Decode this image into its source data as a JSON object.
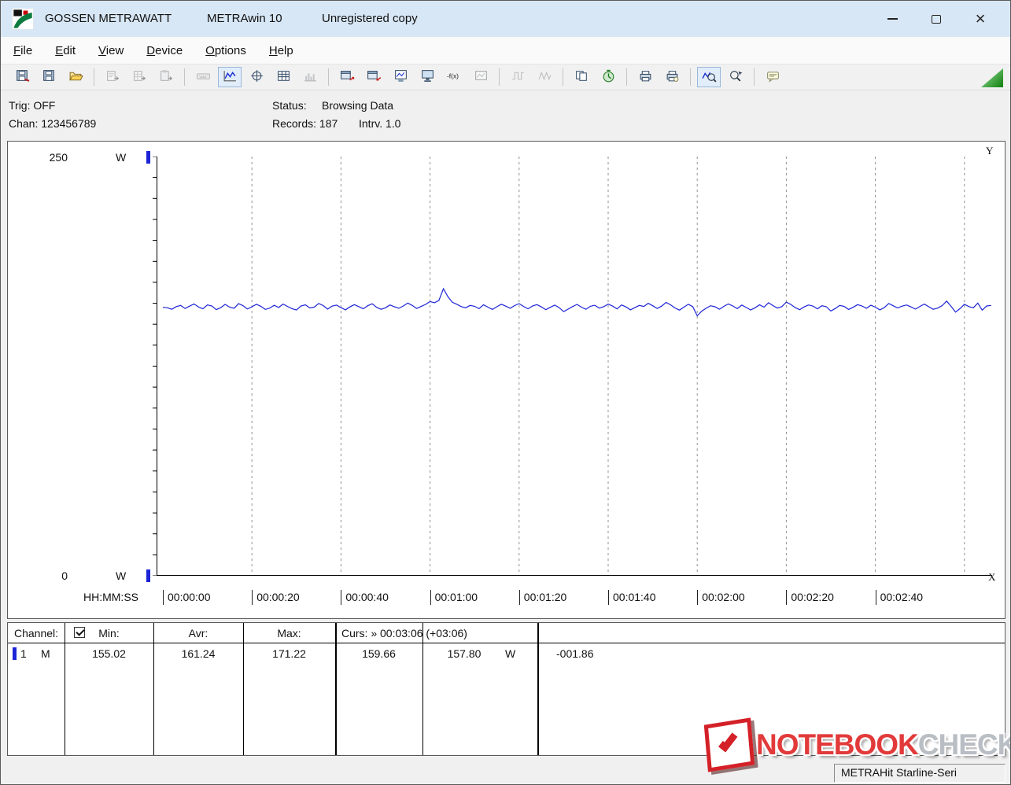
{
  "window": {
    "brand": "GOSSEN METRAWATT",
    "app": "METRAwin 10",
    "license": "Unregistered copy"
  },
  "menu": {
    "items": [
      {
        "mnemonic": "F",
        "rest": "ile"
      },
      {
        "mnemonic": "E",
        "rest": "dit"
      },
      {
        "mnemonic": "V",
        "rest": "iew"
      },
      {
        "mnemonic": "D",
        "rest": "evice"
      },
      {
        "mnemonic": "O",
        "rest": "ptions"
      },
      {
        "mnemonic": "H",
        "rest": "elp"
      }
    ]
  },
  "toolbar": {
    "buttons": [
      {
        "name": "save-as",
        "state": "normal"
      },
      {
        "name": "save",
        "state": "normal"
      },
      {
        "name": "open",
        "state": "normal"
      },
      {
        "type": "sep"
      },
      {
        "name": "export-text",
        "state": "disabled"
      },
      {
        "name": "export-table",
        "state": "disabled"
      },
      {
        "name": "export-clip",
        "state": "disabled"
      },
      {
        "type": "sep"
      },
      {
        "name": "keyboard",
        "state": "disabled"
      },
      {
        "name": "line-chart",
        "state": "pressed"
      },
      {
        "name": "crosshair",
        "state": "normal"
      },
      {
        "name": "table",
        "state": "normal"
      },
      {
        "name": "histogram",
        "state": "disabled"
      },
      {
        "type": "sep"
      },
      {
        "name": "dev-out",
        "state": "normal"
      },
      {
        "name": "dev-in",
        "state": "normal"
      },
      {
        "name": "meter",
        "state": "normal"
      },
      {
        "name": "monitor",
        "state": "normal"
      },
      {
        "name": "formula",
        "state": "normal"
      },
      {
        "name": "screen",
        "state": "disabled"
      },
      {
        "type": "sep"
      },
      {
        "name": "pulse",
        "state": "disabled"
      },
      {
        "name": "wave",
        "state": "disabled"
      },
      {
        "type": "sep"
      },
      {
        "name": "copy",
        "state": "normal"
      },
      {
        "name": "timer",
        "state": "normal"
      },
      {
        "type": "sep"
      },
      {
        "name": "print",
        "state": "normal"
      },
      {
        "name": "print-setup",
        "state": "normal"
      },
      {
        "type": "sep"
      },
      {
        "name": "zoom",
        "state": "pressed"
      },
      {
        "name": "zoom-select",
        "state": "normal"
      },
      {
        "type": "sep"
      },
      {
        "name": "annotation",
        "state": "normal"
      }
    ]
  },
  "status_panel": {
    "trig": "Trig: OFF",
    "chan": "Chan: 123456789",
    "status_label": "Status:",
    "status_value": "Browsing Data",
    "records": "Records: 187",
    "interval": "Intrv. 1.0"
  },
  "chart": {
    "y_top_label": "250",
    "y_bottom_label": "0",
    "y_unit": "W",
    "x_axis_title": "HH:MM:SS",
    "x_ticks": [
      "00:00:00",
      "00:00:20",
      "00:00:40",
      "00:01:00",
      "00:01:20",
      "00:01:40",
      "00:02:00",
      "00:02:20",
      "00:02:40"
    ],
    "y_scroll_label": "Y",
    "x_scroll_label": "X"
  },
  "chart_data": {
    "type": "line",
    "ylabel": "W",
    "ylim": [
      0,
      250
    ],
    "x_unit": "seconds",
    "interval_s": 1.0,
    "records": 187,
    "x_tick_labels": [
      "00:00:00",
      "00:00:20",
      "00:00:40",
      "00:01:00",
      "00:01:20",
      "00:01:40",
      "00:02:00",
      "00:02:20",
      "00:02:40"
    ],
    "series": [
      {
        "name": "1 M",
        "values": [
          160.1,
          159.8,
          158.9,
          160.5,
          161.2,
          159.4,
          160.8,
          162.1,
          160.3,
          159.2,
          161.5,
          160.9,
          158.7,
          159.9,
          161.8,
          160.2,
          159.5,
          162.3,
          161.0,
          159.1,
          160.4,
          161.9,
          160.7,
          158.8,
          159.6,
          161.3,
          160.0,
          162.0,
          160.6,
          159.3,
          158.5,
          160.9,
          161.6,
          159.7,
          160.2,
          162.4,
          161.1,
          159.0,
          160.8,
          161.4,
          159.9,
          158.6,
          160.3,
          161.7,
          160.5,
          159.2,
          161.0,
          162.2,
          160.1,
          158.9,
          159.8,
          161.5,
          160.4,
          159.5,
          160.9,
          162.6,
          161.2,
          159.4,
          160.6,
          161.8,
          163.5,
          162.8,
          164.2,
          171.22,
          166.5,
          163.1,
          161.9,
          160.5,
          159.8,
          161.2,
          160.7,
          159.3,
          161.6,
          160.2,
          158.8,
          160.4,
          161.9,
          160.8,
          159.5,
          161.1,
          162.3,
          160.6,
          159.2,
          160.9,
          161.7,
          160.3,
          158.7,
          160.1,
          161.4,
          159.9,
          157.5,
          159.0,
          160.5,
          161.8,
          160.2,
          158.9,
          160.7,
          161.3,
          159.6,
          160.4,
          162.0,
          160.8,
          159.1,
          161.5,
          160.3,
          158.6,
          159.9,
          161.2,
          160.6,
          162.5,
          161.0,
          159.4,
          160.8,
          163.0,
          161.6,
          159.7,
          158.4,
          160.2,
          161.9,
          160.5,
          155.02,
          157.8,
          159.5,
          161.0,
          160.4,
          158.9,
          160.7,
          162.1,
          160.9,
          159.3,
          161.4,
          160.0,
          158.5,
          159.8,
          161.6,
          160.2,
          162.8,
          161.1,
          159.6,
          160.5,
          163.2,
          161.8,
          159.9,
          158.7,
          160.3,
          161.5,
          160.8,
          159.2,
          161.0,
          160.4,
          157.9,
          159.4,
          161.2,
          160.6,
          158.8,
          160.1,
          161.7,
          160.9,
          159.5,
          161.3,
          160.2,
          158.6,
          159.9,
          162.4,
          161.0,
          159.7,
          160.8,
          161.5,
          160.3,
          159.0,
          160.6,
          162.0,
          160.4,
          158.9,
          159.6,
          161.1,
          163.8,
          160.7,
          157.2,
          159.3,
          161.9,
          160.5,
          159.8,
          162.6,
          158.4,
          160.9,
          161.2
        ]
      }
    ],
    "stats": {
      "min": 155.02,
      "avr": 161.24,
      "max": 171.22,
      "cursor_time": "00:03:06",
      "cursor_value_1": 159.66,
      "cursor_value_2": 157.8,
      "cursor_delta": -1.86
    }
  },
  "table": {
    "channel_header": "Channel:",
    "min_header": "Min:",
    "avr_header": "Avr:",
    "max_header": "Max:",
    "curs_header": "Curs: » 00:03:06 (+03:06)",
    "row": {
      "channel": "1",
      "flag": "M",
      "min": "155.02",
      "avr": "161.24",
      "max": "171.22",
      "curs_a": "159.66",
      "curs_b": "157.80",
      "unit": "W",
      "delta": "-001.86"
    }
  },
  "statusbar": {
    "device": "METRAHit Starline-Seri"
  },
  "watermark": {
    "part1": "NOTEBOOK",
    "part2": "CHECK"
  },
  "colors": {
    "chart_line": "#1d24d6",
    "channel_marker": "#1d24d6",
    "titlebar_bg": "#d8e7f5",
    "triangle_green": "#0e7e0e"
  }
}
